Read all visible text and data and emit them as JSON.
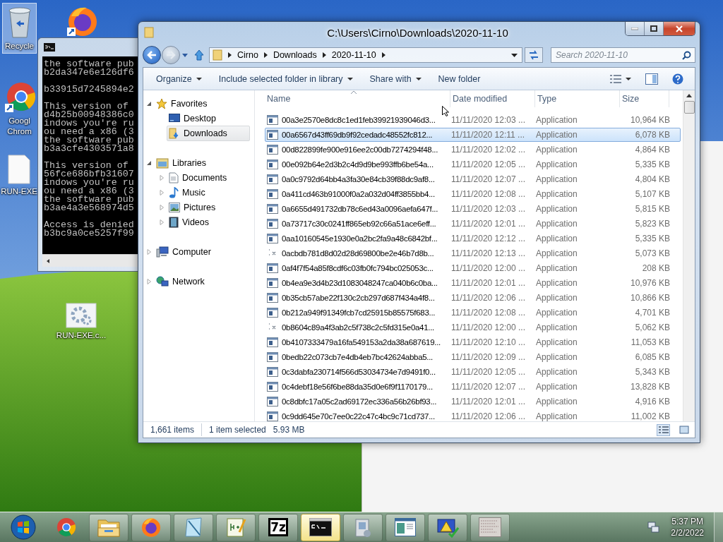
{
  "desktop_icons": [
    {
      "kind": "recycle-bin",
      "lines": [
        "Recycle"
      ],
      "selected": true
    },
    {
      "kind": "firefox",
      "selected": false
    },
    {
      "kind": "chrome",
      "lines": [
        "Googl",
        "Chrom"
      ],
      "selected": false
    },
    {
      "kind": "blank-file",
      "lines": [
        "RUN-EXE"
      ],
      "selected": false
    },
    {
      "kind": "gear-file",
      "lines": [
        "RUN-EXE.c..."
      ],
      "selected": false
    }
  ],
  "console": {
    "paragraphs": [
      [
        "the software pub",
        "b2da347e6e126df6"
      ],
      [
        "b33915d7245894e2"
      ],
      [
        "This version of",
        "d4b25b00948386c0",
        "indows you're ru",
        "ou need a x86 (3",
        "the software pub",
        "b3a3cfe4303571a8"
      ],
      [
        "This version of",
        "56fce686bfb31607",
        "indows you're ru",
        "ou need a x86 (3",
        "the software pub",
        "b3ae4a3e568974d5"
      ],
      [
        "Access is denied",
        "b3bc9a0ce5257f99"
      ]
    ]
  },
  "explorer": {
    "title": "C:\\Users\\Cirno\\Downloads\\2020-11-10",
    "breadcrumb": [
      "Cirno",
      "Downloads",
      "2020-11-10"
    ],
    "search": {
      "placeholder": "Search 2020-11-10"
    },
    "toolbar": [
      {
        "label": "Organize",
        "dropdown": true
      },
      {
        "label": "Include selected folder in library",
        "dropdown": true
      },
      {
        "label": "Share with",
        "dropdown": true
      },
      {
        "label": "New folder",
        "dropdown": false
      }
    ],
    "nav_tree": [
      {
        "label": "Favorites",
        "kind": "star",
        "expanded": true,
        "selected": false,
        "children": [
          {
            "label": "Desktop",
            "kind": "desktop",
            "selected": false
          },
          {
            "label": "Downloads",
            "kind": "downloads",
            "selected": true
          }
        ]
      },
      {
        "label": "Libraries",
        "kind": "library",
        "expanded": true,
        "selected": false,
        "children": [
          {
            "label": "Documents",
            "kind": "document",
            "expanded": false,
            "selected": false
          },
          {
            "label": "Music",
            "kind": "music",
            "expanded": false,
            "selected": false
          },
          {
            "label": "Pictures",
            "kind": "pictures",
            "expanded": false,
            "selected": false
          },
          {
            "label": "Videos",
            "kind": "videos",
            "expanded": false,
            "selected": false
          }
        ]
      },
      {
        "label": "Computer",
        "kind": "computer",
        "expanded": false,
        "selected": false
      },
      {
        "label": "Network",
        "kind": "network",
        "expanded": false,
        "selected": false
      }
    ],
    "columns": [
      "Name",
      "Date modified",
      "Type",
      "Size"
    ],
    "rows": [
      {
        "name": "00a3e2570e8dc8c1ed1feb39921939046d3...",
        "date": "11/11/2020 12:03 ...",
        "type": "Application",
        "size": "10,964 KB",
        "kind": "exe",
        "selected": false
      },
      {
        "name": "00a6567d43ff69db9f92cedadc48552fc812...",
        "date": "11/11/2020 12:11 ...",
        "type": "Application",
        "size": "6,078 KB",
        "kind": "exe",
        "selected": true
      },
      {
        "name": "00d822899fe900e916ee2c00db7274294f48...",
        "date": "11/11/2020 12:02 ...",
        "type": "Application",
        "size": "4,864 KB",
        "kind": "exe",
        "selected": false
      },
      {
        "name": "00e092b64e2d3b2c4d9d9be993ffb6be54a...",
        "date": "11/11/2020 12:05 ...",
        "type": "Application",
        "size": "5,335 KB",
        "kind": "exe",
        "selected": false
      },
      {
        "name": "0a0c9792d64bb4a3fa30e84cb39f88dc9af8...",
        "date": "11/11/2020 12:07 ...",
        "type": "Application",
        "size": "4,804 KB",
        "kind": "exe",
        "selected": false
      },
      {
        "name": "0a411cd463b91000f0a2a032d04ff3855bb4...",
        "date": "11/11/2020 12:08 ...",
        "type": "Application",
        "size": "5,107 KB",
        "kind": "exe",
        "selected": false
      },
      {
        "name": "0a6655d491732db78c6ed43a0096aefa647f...",
        "date": "11/11/2020 12:03 ...",
        "type": "Application",
        "size": "5,815 KB",
        "kind": "exe",
        "selected": false
      },
      {
        "name": "0a73717c30c0241ff865eb92c66a51ace6eff...",
        "date": "11/11/2020 12:01 ...",
        "type": "Application",
        "size": "5,823 KB",
        "kind": "exe",
        "selected": false
      },
      {
        "name": "0aa10160545e1930e0a2bc2fa9a48c6842bf...",
        "date": "11/11/2020 12:12 ...",
        "type": "Application",
        "size": "5,335 KB",
        "kind": "exe",
        "selected": false
      },
      {
        "name": "0acbdb781d8d02d28d69800be2e46b7d8b...",
        "date": "11/11/2020 12:13 ...",
        "type": "Application",
        "size": "5,073 KB",
        "kind": "generic",
        "selected": false
      },
      {
        "name": "0af4f7f54a85f8cdf6c03fb0fc794bc025053c...",
        "date": "11/11/2020 12:00 ...",
        "type": "Application",
        "size": "208 KB",
        "kind": "exe",
        "selected": false
      },
      {
        "name": "0b4ea9e3d4b23d1083048247ca040b6c0ba...",
        "date": "11/11/2020 12:01 ...",
        "type": "Application",
        "size": "10,976 KB",
        "kind": "exe",
        "selected": false
      },
      {
        "name": "0b35cb57abe22f130c2cb297d687f434a4f8...",
        "date": "11/11/2020 12:06 ...",
        "type": "Application",
        "size": "10,866 KB",
        "kind": "exe",
        "selected": false
      },
      {
        "name": "0b212a949f91349fcb7cd25915b85575f683...",
        "date": "11/11/2020 12:08 ...",
        "type": "Application",
        "size": "4,701 KB",
        "kind": "exe",
        "selected": false
      },
      {
        "name": "0b8604c89a4f3ab2c5f738c2c5fd315e0a41...",
        "date": "11/11/2020 12:00 ...",
        "type": "Application",
        "size": "5,062 KB",
        "kind": "generic",
        "selected": false
      },
      {
        "name": "0b4107333479a16fa549153a2da38a687619...",
        "date": "11/11/2020 12:10 ...",
        "type": "Application",
        "size": "11,053 KB",
        "kind": "exe",
        "selected": false
      },
      {
        "name": "0bedb22c073cb7e4db4eb7bc42624abba5...",
        "date": "11/11/2020 12:09 ...",
        "type": "Application",
        "size": "6,085 KB",
        "kind": "exe",
        "selected": false
      },
      {
        "name": "0c3dabfa230714f566d53034734e7d9491f0...",
        "date": "11/11/2020 12:05 ...",
        "type": "Application",
        "size": "5,343 KB",
        "kind": "exe",
        "selected": false
      },
      {
        "name": "0c4debf18e56f6be88da35d0e6f9f1170179...",
        "date": "11/11/2020 12:07 ...",
        "type": "Application",
        "size": "13,828 KB",
        "kind": "exe",
        "selected": false
      },
      {
        "name": "0c8dbfc17a05c2ad69172ec336a56b26bf93...",
        "date": "11/11/2020 12:01 ...",
        "type": "Application",
        "size": "4,916 KB",
        "kind": "exe",
        "selected": false
      },
      {
        "name": "0c9dd645e70c7ee0c22c47c4bc9c71cd737...",
        "date": "11/11/2020 12:06 ...",
        "type": "Application",
        "size": "11,002 KB",
        "kind": "exe",
        "selected": false
      }
    ],
    "status": {
      "items": "1,661 items",
      "selection": "1 item selected",
      "size": "5.93 MB"
    }
  },
  "taskbar": {
    "items": [
      {
        "kind": "chrome",
        "running": false,
        "selected": false
      },
      {
        "kind": "folder",
        "running": true,
        "selected": false
      },
      {
        "kind": "firefox",
        "running": true,
        "selected": false
      },
      {
        "kind": "notepad",
        "running": true,
        "selected": false
      },
      {
        "kind": "notepadpp",
        "running": true,
        "selected": false
      },
      {
        "kind": "sevenzip",
        "label": "7z",
        "running": true,
        "selected": false
      },
      {
        "kind": "console",
        "running": true,
        "selected": true
      },
      {
        "kind": "installer",
        "running": true,
        "selected": false
      },
      {
        "kind": "window",
        "running": true,
        "selected": false
      },
      {
        "kind": "warning",
        "running": true,
        "selected": false
      },
      {
        "kind": "image",
        "running": true,
        "selected": false
      }
    ],
    "time": "5:37 PM",
    "date": "2/2/2022"
  }
}
